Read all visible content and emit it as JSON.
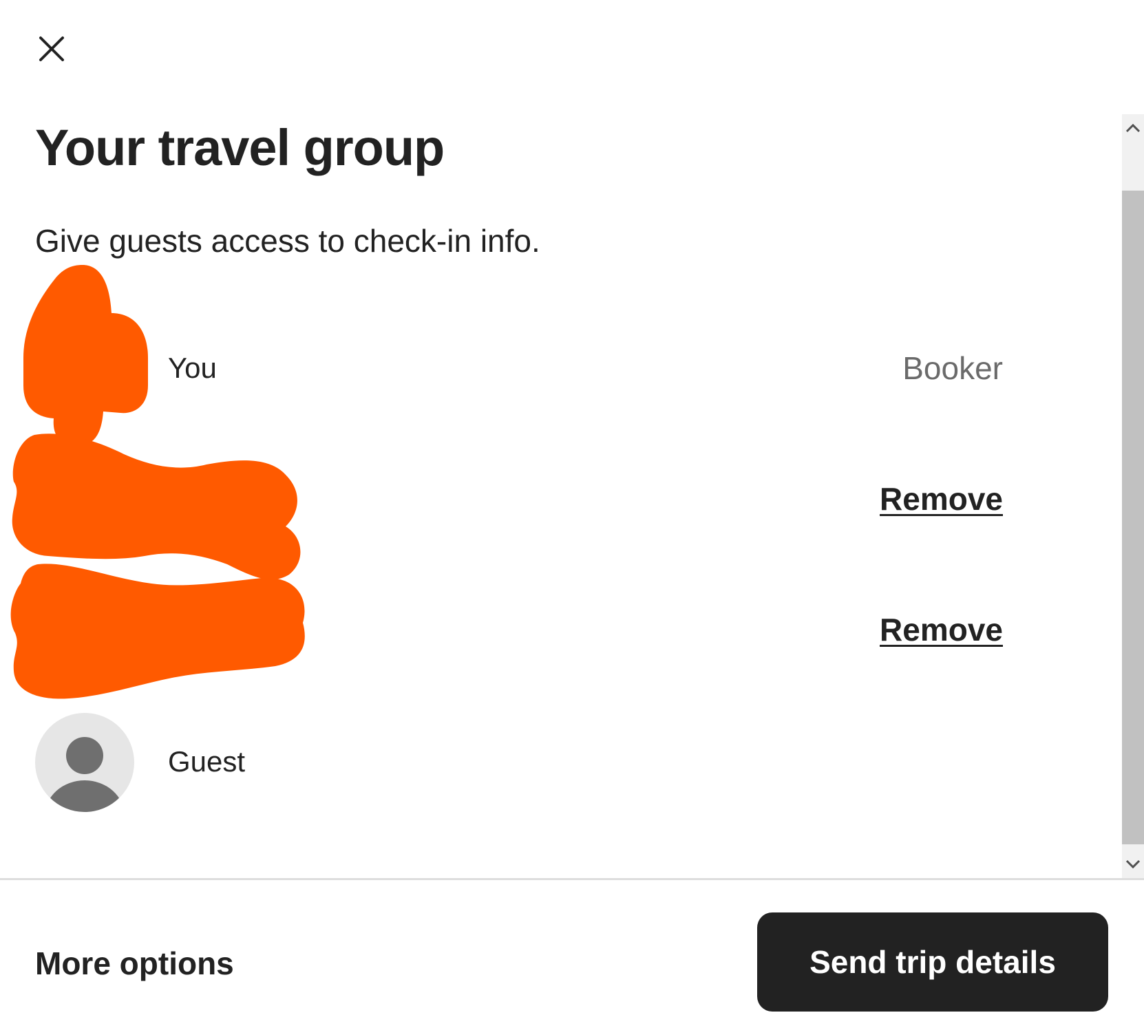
{
  "header": {
    "close_icon": "close-icon",
    "title": "Your travel group",
    "subtitle": "Give guests access to check-in info."
  },
  "members": [
    {
      "name": "You",
      "role": "Booker",
      "avatar": "redacted"
    },
    {
      "action": "Remove",
      "avatar": "redacted"
    },
    {
      "action": "Remove",
      "avatar": "redacted"
    },
    {
      "name": "Guest",
      "avatar": "default-person-icon"
    }
  ],
  "footer": {
    "more_options_label": "More options",
    "send_button_label": "Send trip details"
  },
  "colors": {
    "text": "#222222",
    "muted_text": "#6a6a6a",
    "button_bg": "#222222",
    "button_text": "#ffffff",
    "avatar_bg": "#e6e6e6",
    "avatar_icon": "#6f6f6f",
    "redaction": "#ff5a00",
    "divider": "#dddddd"
  }
}
